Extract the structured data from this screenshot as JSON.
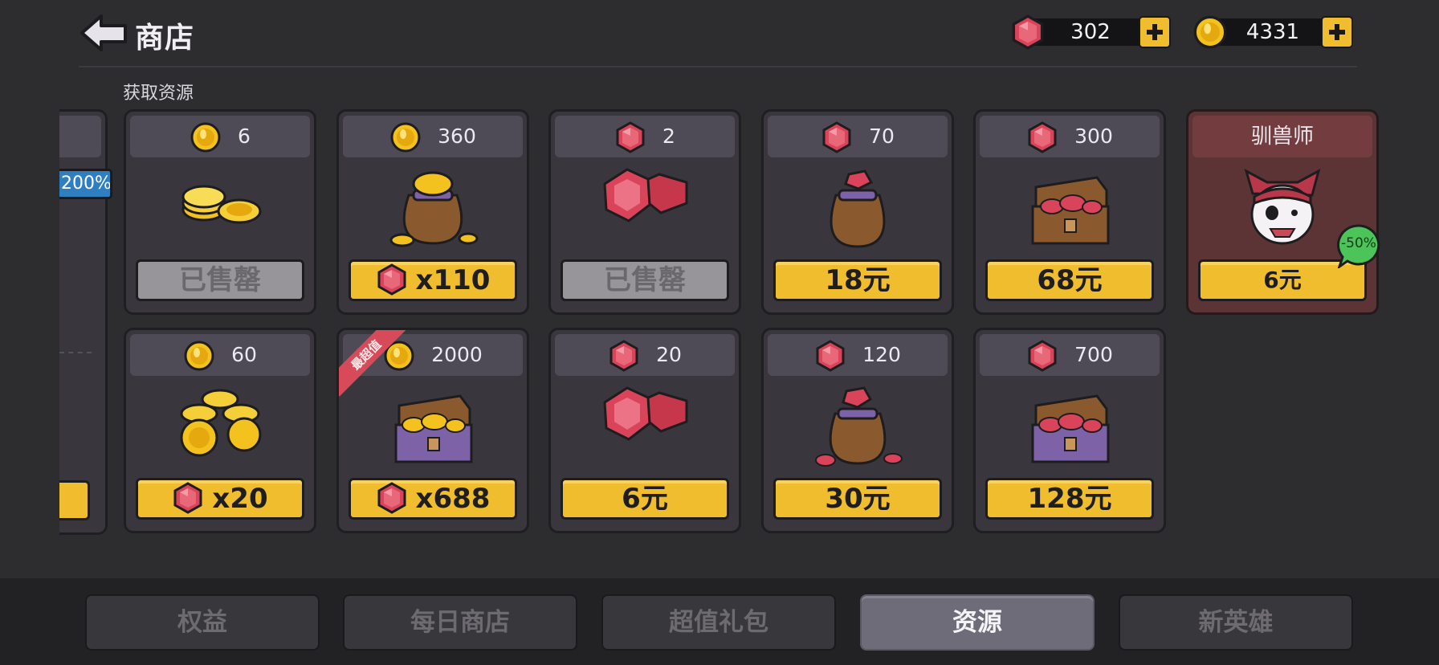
{
  "header": {
    "title": "商店",
    "gems": "302",
    "coins": "4331"
  },
  "section_title": "获取资源",
  "partial_card": {
    "bonus": "200%"
  },
  "cards": [
    {
      "currency": "coin",
      "amount": "6",
      "art": "coin-pile-small",
      "price": "已售罄",
      "price_style": "soldout"
    },
    {
      "currency": "coin",
      "amount": "360",
      "art": "coin-sack",
      "price": "x110",
      "price_icon": "gem",
      "price_style": "gold"
    },
    {
      "currency": "gem",
      "amount": "2",
      "art": "gem-pair",
      "price": "已售罄",
      "price_style": "soldout"
    },
    {
      "currency": "gem",
      "amount": "70",
      "art": "gem-sack",
      "price": "18元",
      "price_style": "gold"
    },
    {
      "currency": "gem",
      "amount": "300",
      "art": "gem-chest",
      "price": "68元",
      "price_style": "gold"
    },
    {
      "currency": "none",
      "amount": "驯兽师",
      "art": "hero-tamer",
      "price": "6元",
      "price_style": "gold",
      "discount": "-50%"
    },
    {
      "currency": "coin",
      "amount": "60",
      "art": "coin-pile-large",
      "price": "x20",
      "price_icon": "gem",
      "price_style": "gold"
    },
    {
      "currency": "coin",
      "amount": "2000",
      "art": "coin-chest",
      "price": "x688",
      "price_icon": "gem",
      "price_style": "gold",
      "ribbon": "最超值"
    },
    {
      "currency": "gem",
      "amount": "20",
      "art": "gem-pair",
      "price": "6元",
      "price_style": "gold"
    },
    {
      "currency": "gem",
      "amount": "120",
      "art": "gem-sack-big",
      "price": "30元",
      "price_style": "gold"
    },
    {
      "currency": "gem",
      "amount": "700",
      "art": "gem-chest-big",
      "price": "128元",
      "price_style": "gold"
    }
  ],
  "tabs": [
    {
      "label": "权益",
      "active": false
    },
    {
      "label": "每日商店",
      "active": false
    },
    {
      "label": "超值礼包",
      "active": false
    },
    {
      "label": "资源",
      "active": true
    },
    {
      "label": "新英雄",
      "active": false
    }
  ],
  "colors": {
    "button_gold": "#f0bd2e",
    "gem_red": "#d9445a",
    "coin_gold": "#f3c21f",
    "tab_active": "#6f6c79",
    "tamer_card": "#5c3436"
  }
}
